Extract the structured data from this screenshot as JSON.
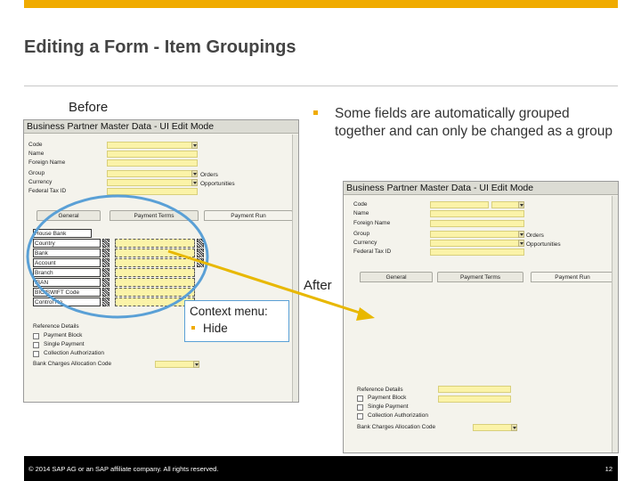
{
  "slide": {
    "title": "Editing a Form - Item Groupings",
    "before_label": "Before",
    "after_label": "After",
    "bullet": "Some fields are automatically grouped together and can only be changed as a group",
    "context_menu_title": "Context menu:",
    "context_menu_item": "Hide",
    "footer_copyright": "© 2014 SAP AG or an SAP affiliate company. All rights reserved.",
    "page_number": "12"
  },
  "colors": {
    "accent": "#f0ab00",
    "ellipse": "#5aa0d6",
    "arrow": "#e8b800",
    "field_yellow": "#fbf3a8"
  },
  "before_window": {
    "title": "Business Partner Master Data - UI Edit Mode",
    "fields": [
      "Code",
      "Name",
      "Foreign Name",
      "Group",
      "Currency",
      "Federal Tax ID"
    ],
    "right_labels": [
      "Orders",
      "Opportunities"
    ],
    "tabs": [
      "General",
      "Payment Terms",
      "Payment Run"
    ],
    "grouped_fields": [
      "House Bank",
      "Country",
      "Bank",
      "Account",
      "Branch",
      "IBAN",
      "BIC/SWIFT Code",
      "Control No."
    ],
    "reference_details": "Reference Details",
    "checkboxes": [
      "Payment Block",
      "Single Payment",
      "Collection Authorization"
    ],
    "bank_charges": "Bank Charges Allocation Code"
  },
  "after_window": {
    "title": "Business Partner Master Data - UI Edit Mode",
    "fields": [
      "Code",
      "Name",
      "Foreign Name",
      "Group",
      "Currency",
      "Federal Tax ID"
    ],
    "right_labels": [
      "Orders",
      "Opportunities"
    ],
    "tabs": [
      "General",
      "Payment Terms",
      "Payment Run"
    ],
    "reference_details": "Reference Details",
    "checkboxes": [
      "Payment Block",
      "Single Payment",
      "Collection Authorization"
    ],
    "bank_charges": "Bank Charges Allocation Code"
  }
}
